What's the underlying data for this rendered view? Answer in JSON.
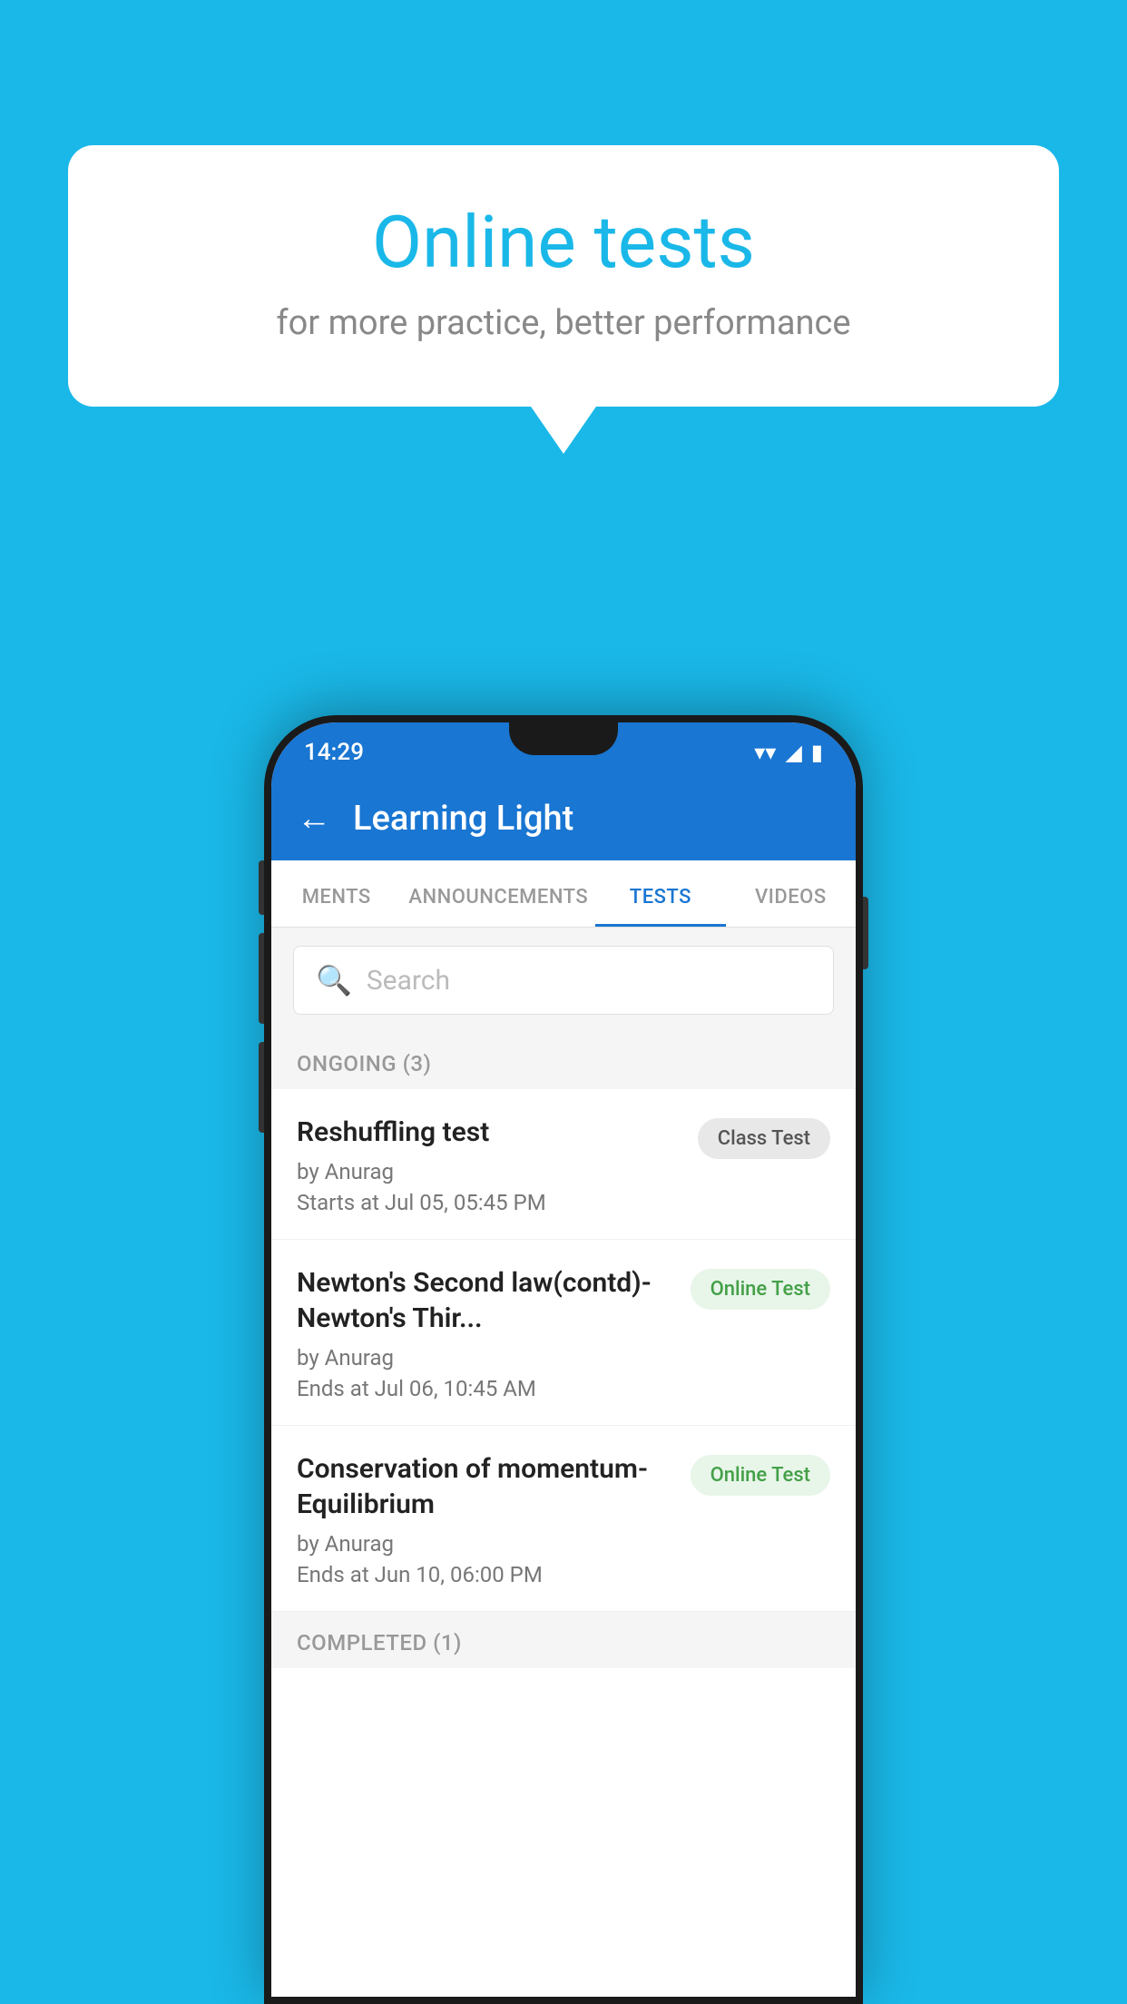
{
  "background_color": "#1ab8e8",
  "bubble": {
    "title": "Online tests",
    "subtitle": "for more practice, better performance"
  },
  "phone": {
    "status_bar": {
      "time": "14:29",
      "wifi": "▾",
      "signal": "▲",
      "battery": "▮"
    },
    "header": {
      "back_label": "←",
      "title": "Learning Light"
    },
    "tabs": [
      {
        "label": "MENTS",
        "active": false
      },
      {
        "label": "ANNOUNCEMENTS",
        "active": false
      },
      {
        "label": "TESTS",
        "active": true
      },
      {
        "label": "VIDEOS",
        "active": false
      }
    ],
    "search": {
      "placeholder": "Search",
      "icon": "🔍"
    },
    "ongoing_section": {
      "label": "ONGOING (3)",
      "tests": [
        {
          "name": "Reshuffling test",
          "author": "by Anurag",
          "date": "Starts at  Jul 05, 05:45 PM",
          "badge": "Class Test",
          "badge_type": "class"
        },
        {
          "name": "Newton's Second law(contd)-Newton's Thir...",
          "author": "by Anurag",
          "date": "Ends at  Jul 06, 10:45 AM",
          "badge": "Online Test",
          "badge_type": "online"
        },
        {
          "name": "Conservation of momentum-Equilibrium",
          "author": "by Anurag",
          "date": "Ends at  Jun 10, 06:00 PM",
          "badge": "Online Test",
          "badge_type": "online"
        }
      ]
    },
    "completed_section": {
      "label": "COMPLETED (1)"
    }
  }
}
